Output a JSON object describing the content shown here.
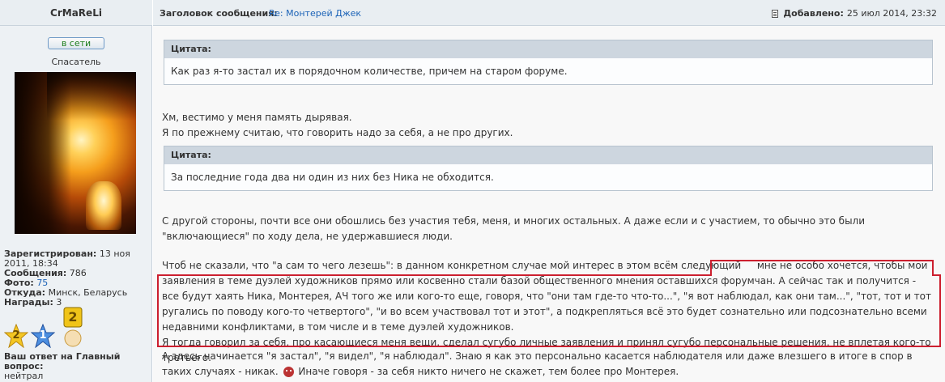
{
  "author": {
    "name": "CrMaReLi",
    "status": "в сети",
    "rank": "Спасатель",
    "stats": [
      {
        "label": "Зарегистрирован:",
        "value": "13 ноя 2011, 18:34"
      },
      {
        "label": "Сообщения:",
        "value": "786"
      },
      {
        "label": "Фото:",
        "value": "75"
      },
      {
        "label": "Откуда:",
        "value": "Минск, Беларусь"
      },
      {
        "label": "Награды:",
        "value": "3"
      }
    ],
    "medals": [
      "2",
      "1",
      "2"
    ],
    "answer_label": "Ваш ответ на Главный вопрос:",
    "answer_value": "нейтрал"
  },
  "post": {
    "subject_label": "Заголовок сообщения:",
    "subject_value": "Re: Монтерей Джек",
    "added_label": "Добавлено:",
    "added_value": "25 июл 2014, 23:32",
    "quotes": [
      {
        "title": "Цитата:",
        "text": "Как раз я-то застал их в порядочном количестве, причем на старом форуме."
      },
      {
        "title": "Цитата:",
        "text": "За последние года два ни один из них без Ника не обходится."
      }
    ],
    "p1_line1": "Хм, вестимо у меня память дырявая.",
    "p1_line2": "Я по прежнему считаю, что говорить надо за себя, а не про других.",
    "p2": "С другой стороны, почти все они обошлись без участия тебя, меня, и многих остальных. А даже если и с участием, то обычно это были \"включающиеся\" по ходу дела, не удержавшиеся люди.",
    "p3_start": "Чтоб не сказали, что \"а сам то чего лезешь\": в данном конкретном случае мой интерес в этом всём следующий",
    "p3_hl": "мне не особо хочется, чтобы мои заявления в теме дуэлей художников прямо или косвенно стали базой общественного мнения оставшихся форумчан. А сейчас так и получится - все будут хаять Ника, Монтерея, АЧ того же или кого-то еще, говоря, что \"они там где-то что-то...\", \"я вот наблюдал, как они там...\", \"тот, тот и тот ругались по поводу кого-то четвертого\", \"и во всем участвовал тот и этот\", а подкрепляться всё это будет сознательно или подсознательно всеми недавними конфликтами, в том числе и в теме дуэлей художников.",
    "p3_hl2": "Я тогда говорил за себя, про касающиеся меня вещи, сделал сугубо личные заявления и принял сугубо персональные решения, не вплетая кого-то третьего.",
    "p4a": "А здесь начинается \"я застал\", \"я видел\", \"я наблюдал\". Знаю я как это персонально касается наблюдателя или даже влезшего в итоге в спор в таких случаях - никак.",
    "p4b": "Иначе говоря - за себя никто ничего не скажет, тем более про Монтерея."
  },
  "colors": {
    "link": "#1c63b7",
    "online": "#1e7f1e",
    "highlight_border": "#cc1f2f",
    "quote_header": "#cdd6df"
  },
  "icons": [
    "document-icon",
    "star-gold-icon",
    "star-blue-icon",
    "medal-gold-icon",
    "smiley-icon"
  ]
}
